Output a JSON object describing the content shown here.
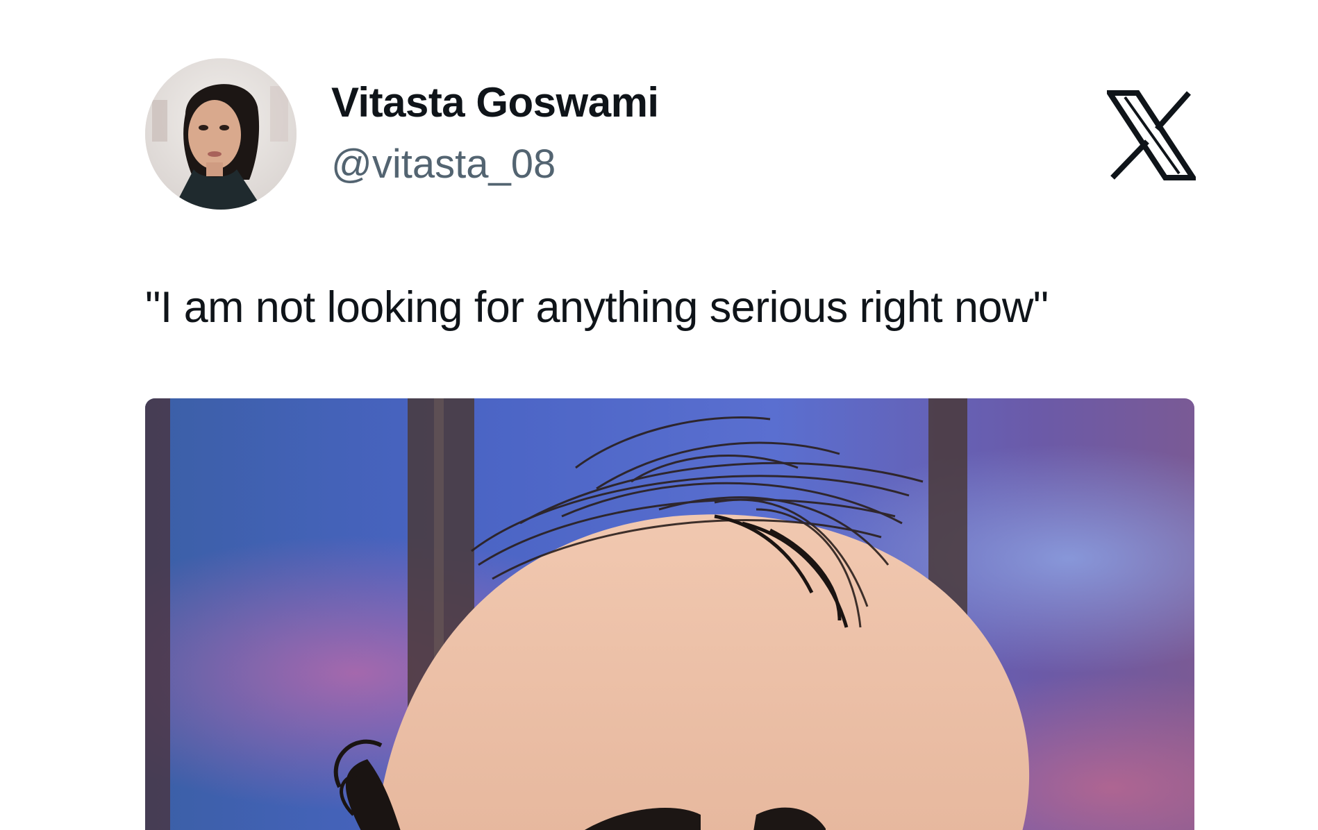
{
  "tweet": {
    "author": {
      "display_name": "Vitasta Goswami",
      "handle": "@vitasta_08",
      "avatar_icon": "profile-photo"
    },
    "platform_icon": "x-logo-icon",
    "text": "\"I am not looking for anything serious right now\"",
    "media": {
      "type": "image",
      "description_icon": "cartoon-balding-head-image"
    }
  },
  "colors": {
    "text_primary": "#0f1419",
    "text_secondary": "#536471",
    "background": "#ffffff"
  }
}
